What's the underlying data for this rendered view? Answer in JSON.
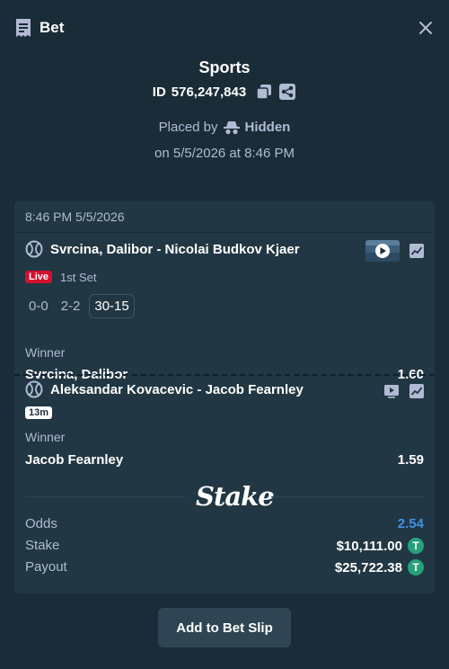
{
  "header": {
    "title": "Bet",
    "icon": "bet-slip-icon",
    "close_icon": "close-icon"
  },
  "bet": {
    "sport": "Sports",
    "id_label": "ID",
    "id_value": "576,247,843",
    "placed_by_label": "Placed by",
    "placed_by_user": "Hidden",
    "placed_on": "on 5/5/2026 at 8:46 PM"
  },
  "card": {
    "timestamp": "8:46 PM 5/5/2026",
    "legs": [
      {
        "sport_icon": "tennis-ball-icon",
        "match": "Svrcina, Dalibor - Nicolai Budkov Kjaer",
        "status_badge": "Live",
        "period": "1st Set",
        "scores": [
          "0-0",
          "2-2",
          "30-15"
        ],
        "market": "Winner",
        "selection": "Svrcina, Dalibor",
        "odds": "1.60"
      },
      {
        "sport_icon": "tennis-ball-icon",
        "match": "Aleksandar Kovacevic - Jacob Fearnley",
        "time_badge": "13m",
        "market": "Winner",
        "selection": "Jacob Fearnley",
        "odds": "1.59"
      }
    ],
    "brand": "Stake",
    "summary": {
      "odds_label": "Odds",
      "odds_value": "2.54",
      "stake_label": "Stake",
      "stake_value": "$10,111.00",
      "payout_label": "Payout",
      "payout_value": "$25,722.38",
      "currency_icon": "tether-icon",
      "currency_glyph": "T"
    }
  },
  "actions": {
    "add_to_bet_slip": "Add to Bet Slip"
  },
  "colors": {
    "background": "#1a2c38",
    "card": "#213743",
    "accent_blue": "#4391e7",
    "live_red": "#d5102f",
    "tether_green": "#26a17b"
  }
}
